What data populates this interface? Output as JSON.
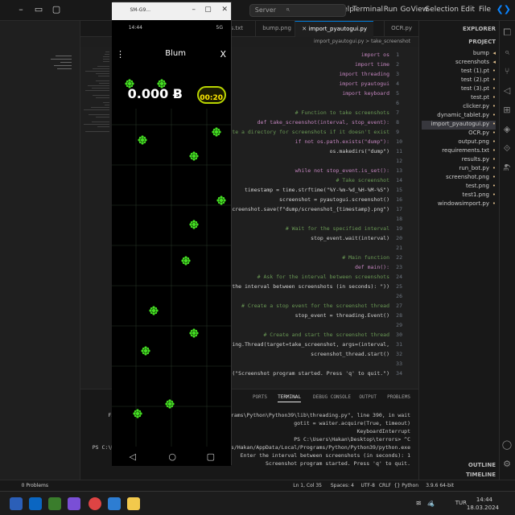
{
  "titlebar": {
    "search": "Server",
    "menu": [
      "File",
      "Edit",
      "Selection",
      "View",
      "Go",
      "Run",
      "Terminal",
      "Help"
    ]
  },
  "explorer": {
    "title": "EXPLORER",
    "root": "EXPLORER",
    "folder": "PROJECT",
    "items": [
      "bump",
      "screenshots",
      "test (1).pt",
      "test (2).pt",
      "test (3).pt",
      "test.pt",
      "clicker.py",
      "dynamic_tablet.py",
      "import_pyautogui.py",
      "OCR.py",
      "output.png",
      "requirements.txt",
      "results.py",
      "run_bot.py",
      "screenshot.png",
      "test.png",
      "test1.png",
      "windowsimport.py"
    ],
    "outline": "OUTLINE",
    "timeline": "TIMELINE"
  },
  "tabs": [
    {
      "label": "OCR.py",
      "active": false
    },
    {
      "label": "import_pyautogui.py",
      "active": true
    },
    {
      "label": "bump.png",
      "active": false
    },
    {
      "label": "requirements.txt",
      "active": false
    }
  ],
  "breadcrumb": "import_pyautogui.py > take_screenshot",
  "code": [
    {
      "n": "1",
      "t": "import os"
    },
    {
      "n": "2",
      "t": "import time"
    },
    {
      "n": "3",
      "t": "import threading"
    },
    {
      "n": "4",
      "t": "import pyautogui"
    },
    {
      "n": "5",
      "t": "import keyboard"
    },
    {
      "n": "6",
      "t": ""
    },
    {
      "n": "7",
      "t": "# Function to take screenshots"
    },
    {
      "n": "8",
      "t": "def take_screenshot(interval, stop_event):"
    },
    {
      "n": "9",
      "t": "    # Create a directory for screenshots if it doesn't exist"
    },
    {
      "n": "10",
      "t": "    if not os.path.exists(\"dump\"):"
    },
    {
      "n": "11",
      "t": "        os.makedirs(\"dump\")"
    },
    {
      "n": "12",
      "t": ""
    },
    {
      "n": "13",
      "t": "    while not stop_event.is_set():"
    },
    {
      "n": "14",
      "t": "        # Take screenshot"
    },
    {
      "n": "15",
      "t": "        timestamp = time.strftime(\"%Y-%m-%d_%H-%M-%S\")"
    },
    {
      "n": "16",
      "t": "        screenshot = pyautogui.screenshot()"
    },
    {
      "n": "17",
      "t": "        screenshot.save(f\"dump/screenshot_{timestamp}.png\")"
    },
    {
      "n": "18",
      "t": ""
    },
    {
      "n": "19",
      "t": "        # Wait for the specified interval"
    },
    {
      "n": "20",
      "t": "        stop_event.wait(interval)"
    },
    {
      "n": "21",
      "t": ""
    },
    {
      "n": "22",
      "t": "# Main function"
    },
    {
      "n": "23",
      "t": "def main():"
    },
    {
      "n": "24",
      "t": "    # Ask for the interval between screenshots"
    },
    {
      "n": "25",
      "t": "    interval = int(input(\"Enter the interval between screenshots (in seconds): \"))"
    },
    {
      "n": "26",
      "t": ""
    },
    {
      "n": "27",
      "t": "    # Create a stop event for the screenshot thread"
    },
    {
      "n": "28",
      "t": "    stop_event = threading.Event()"
    },
    {
      "n": "29",
      "t": ""
    },
    {
      "n": "30",
      "t": "    # Create and start the screenshot thread"
    },
    {
      "n": "31",
      "t": "    screenshot_thread = threading.Thread(target=take_screenshot, args=(interval,"
    },
    {
      "n": "32",
      "t": "    screenshot_thread.start()"
    },
    {
      "n": "33",
      "t": ""
    },
    {
      "n": "34",
      "t": "    print(\"Screenshot program started. Press 'q' to quit.\")"
    }
  ],
  "panel": {
    "tabs": [
      "PROBLEMS",
      "OUTPUT",
      "DEBUG CONSOLE",
      "TERMINAL",
      "PORTS"
    ],
    "active_tab": "TERMINAL",
    "terminal": [
      "File \"C:\\Users\\Hakan\\AppData\\Local\\Programs\\Python\\Python39\\lib\\threading.py\", line 390, in wait",
      "    gotit = waiter.acquire(True, timeout)",
      "KeyboardInterrupt",
      "PS C:\\Users\\Hakan\\Desktop\\terrors> ^C",
      "PS C:\\Users\\Hakan\\Desktop\\terrors> & C:/Users/Hakan/AppData/Local/Programs/Python/Python39/python.exe",
      "Enter the interval between screenshots (in seconds): 1",
      "Screenshot program started. Press 'q' to quit."
    ]
  },
  "statusbar": {
    "left": [
      "Ln 1, Col 35",
      "Spaces: 4",
      "UTF-8",
      "CRLF",
      "{} Python",
      "3.9.6 64-bit"
    ],
    "right": [
      "0 Problems",
      "0",
      "0"
    ]
  },
  "taskbar": {
    "time": "14:44",
    "date": "18.03.2024",
    "lang": "TUR"
  },
  "phone": {
    "window_title": "SM-G9...",
    "status_time": "14:44",
    "status_right": "5G",
    "app_title": "Blum",
    "close_label": "X",
    "menu_label": "⋮",
    "score": "0.000",
    "timer": "00:20",
    "nav_back": "◁",
    "nav_home": "○",
    "nav_recent": "▢"
  },
  "colors": {
    "accent": "#0078d4",
    "flake": "#44dd22",
    "timer_border": "#b8d400"
  }
}
